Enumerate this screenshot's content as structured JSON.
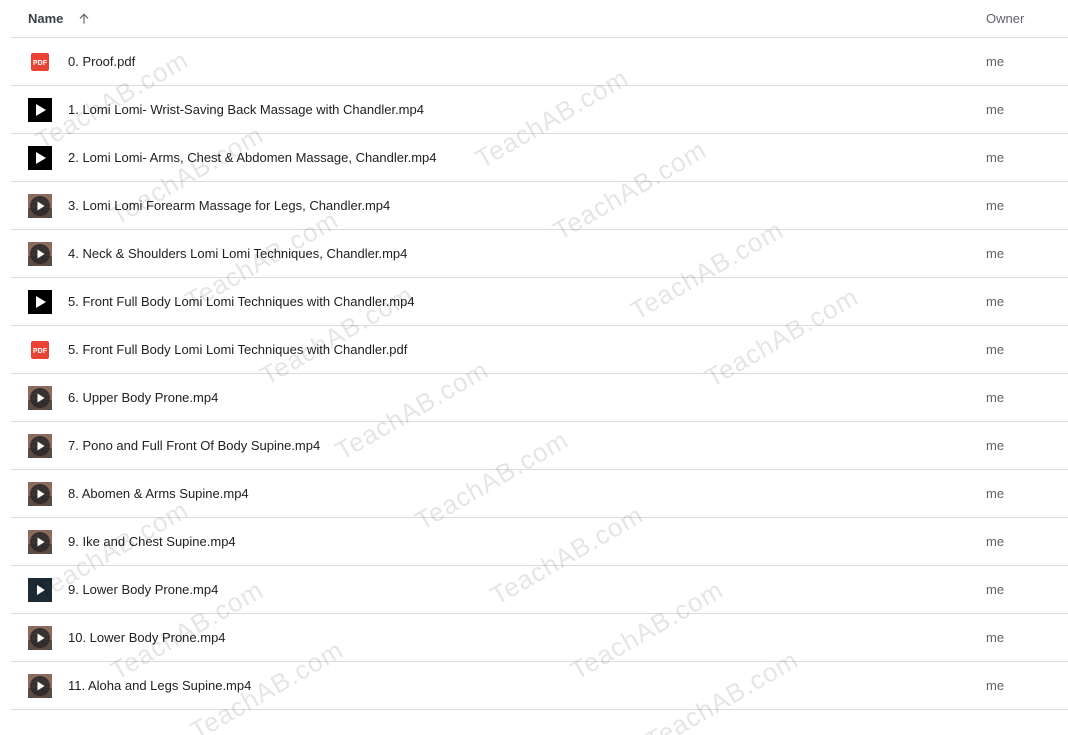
{
  "header": {
    "name_label": "Name",
    "owner_label": "Owner",
    "sort_icon": "arrow-up-icon"
  },
  "watermark_text": "TeachAB.com",
  "rows": [
    {
      "name": "0. Proof.pdf",
      "owner": "me",
      "icon": "pdf-icon"
    },
    {
      "name": "1. Lomi Lomi- Wrist-Saving Back Massage with Chandler.mp4",
      "owner": "me",
      "icon": "video-icon"
    },
    {
      "name": "2. Lomi Lomi- Arms, Chest & Abdomen Massage, Chandler.mp4",
      "owner": "me",
      "icon": "video-icon"
    },
    {
      "name": "3. Lomi Lomi Forearm Massage for Legs, Chandler.mp4",
      "owner": "me",
      "icon": "video-thumbnail-icon"
    },
    {
      "name": "4. Neck & Shoulders Lomi Lomi Techniques, Chandler.mp4",
      "owner": "me",
      "icon": "video-thumbnail-icon"
    },
    {
      "name": "5. Front Full Body Lomi Lomi Techniques with Chandler.mp4",
      "owner": "me",
      "icon": "video-icon"
    },
    {
      "name": "5. Front Full Body Lomi Lomi Techniques with Chandler.pdf",
      "owner": "me",
      "icon": "pdf-icon"
    },
    {
      "name": "6. Upper Body Prone.mp4",
      "owner": "me",
      "icon": "video-thumbnail-icon"
    },
    {
      "name": "7. Pono and Full Front Of Body Supine.mp4",
      "owner": "me",
      "icon": "video-thumbnail-icon"
    },
    {
      "name": "8. Abomen & Arms Supine.mp4",
      "owner": "me",
      "icon": "video-thumbnail-icon"
    },
    {
      "name": "9. Ike and Chest Supine.mp4",
      "owner": "me",
      "icon": "video-thumbnail-icon"
    },
    {
      "name": "9. Lower Body Prone.mp4",
      "owner": "me",
      "icon": "video-dark-icon"
    },
    {
      "name": "10. Lower Body Prone.mp4",
      "owner": "me",
      "icon": "video-thumbnail-icon"
    },
    {
      "name": "11. Aloha and Legs Supine.mp4",
      "owner": "me",
      "icon": "video-thumbnail-icon"
    }
  ],
  "colors": {
    "pdf_red": "#ea4335",
    "divider": "#dadce0",
    "text": "#202124",
    "muted": "#5f6368"
  }
}
